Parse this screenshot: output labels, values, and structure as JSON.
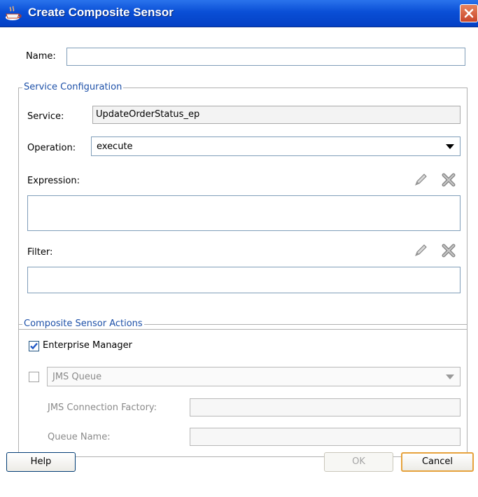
{
  "window": {
    "title": "Create Composite Sensor",
    "close_icon": "close-icon"
  },
  "name": {
    "label": "Name:",
    "value": ""
  },
  "service_config": {
    "title": "Service Configuration",
    "service_label": "Service:",
    "service_value": "UpdateOrderStatus_ep",
    "operation_label": "Operation:",
    "operation_value": "execute",
    "expression_label": "Expression:",
    "expression_value": "",
    "filter_label": "Filter:",
    "filter_value": ""
  },
  "actions": {
    "title": "Composite Sensor Actions",
    "enterprise_manager_label": "Enterprise Manager",
    "enterprise_manager_checked": true,
    "jms_checked": false,
    "jms_type_value": "JMS Queue",
    "jms_connection_factory_label": "JMS Connection Factory:",
    "jms_connection_factory_value": "",
    "queue_name_label": "Queue Name:",
    "queue_name_value": ""
  },
  "buttons": {
    "help": "Help",
    "ok": "OK",
    "cancel": "Cancel"
  },
  "colors": {
    "titlebar": "#0a4fd6",
    "group_title": "#1d50a8",
    "default_button_border": "#e6a23c"
  }
}
